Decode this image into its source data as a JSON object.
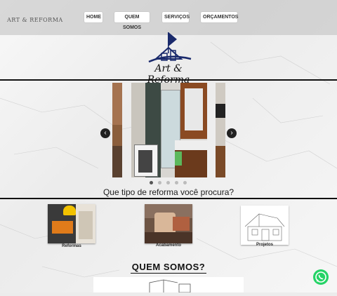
{
  "header": {
    "brand_mini": "ART & REFORMA",
    "nav": [
      "HOME",
      "QUEM SOMOS",
      "SERVIÇOS",
      "ORÇAMENTOS"
    ]
  },
  "logo": {
    "text": "Art & Reforma"
  },
  "carousel": {
    "prev_icon": "chevron-left-icon",
    "next_icon": "chevron-right-icon",
    "dots": 5,
    "active_dot": 0
  },
  "question": "Que tipo de reforma você procura?",
  "services": [
    {
      "label": "Reformas"
    },
    {
      "label": "Acabamento"
    },
    {
      "label": "Projetos"
    }
  ],
  "section_title": "QUEM SOMOS?",
  "whatsapp": {
    "icon": "whatsapp-icon"
  },
  "colors": {
    "nav_bg": "#ffffff",
    "accent_blue": "#1a2a6c",
    "whatsapp": "#25d366"
  }
}
